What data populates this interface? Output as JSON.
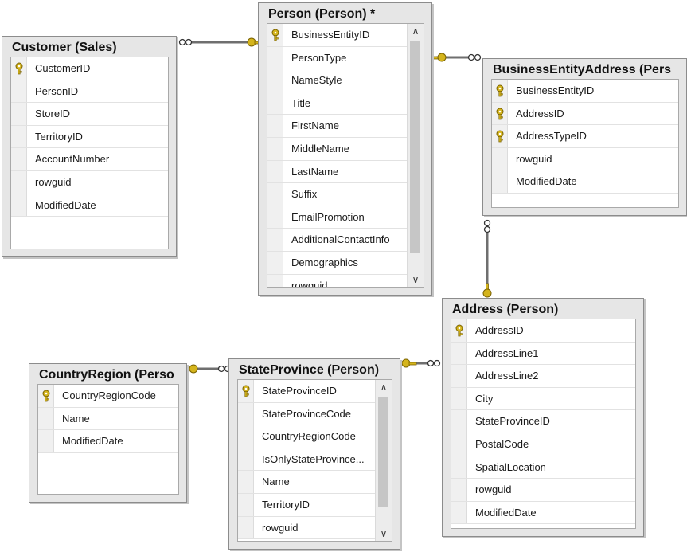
{
  "tables": {
    "customer": {
      "title": "Customer (Sales)",
      "columns": [
        {
          "name": "CustomerID",
          "key": true
        },
        {
          "name": "PersonID",
          "key": false
        },
        {
          "name": "StoreID",
          "key": false
        },
        {
          "name": "TerritoryID",
          "key": false
        },
        {
          "name": "AccountNumber",
          "key": false
        },
        {
          "name": "rowguid",
          "key": false
        },
        {
          "name": "ModifiedDate",
          "key": false
        }
      ]
    },
    "person": {
      "title": "Person (Person) *",
      "columns": [
        {
          "name": "BusinessEntityID",
          "key": true
        },
        {
          "name": "PersonType",
          "key": false
        },
        {
          "name": "NameStyle",
          "key": false
        },
        {
          "name": "Title",
          "key": false
        },
        {
          "name": "FirstName",
          "key": false
        },
        {
          "name": "MiddleName",
          "key": false
        },
        {
          "name": "LastName",
          "key": false
        },
        {
          "name": "Suffix",
          "key": false
        },
        {
          "name": "EmailPromotion",
          "key": false
        },
        {
          "name": "AdditionalContactInfo",
          "key": false
        },
        {
          "name": "Demographics",
          "key": false
        },
        {
          "name": "rowguid",
          "key": false
        }
      ]
    },
    "businessEntityAddress": {
      "title": "BusinessEntityAddress (Pers",
      "columns": [
        {
          "name": "BusinessEntityID",
          "key": true
        },
        {
          "name": "AddressID",
          "key": true
        },
        {
          "name": "AddressTypeID",
          "key": true
        },
        {
          "name": "rowguid",
          "key": false
        },
        {
          "name": "ModifiedDate",
          "key": false
        }
      ]
    },
    "address": {
      "title": "Address (Person)",
      "columns": [
        {
          "name": "AddressID",
          "key": true
        },
        {
          "name": "AddressLine1",
          "key": false
        },
        {
          "name": "AddressLine2",
          "key": false
        },
        {
          "name": "City",
          "key": false
        },
        {
          "name": "StateProvinceID",
          "key": false
        },
        {
          "name": "PostalCode",
          "key": false
        },
        {
          "name": "SpatialLocation",
          "key": false
        },
        {
          "name": "rowguid",
          "key": false
        },
        {
          "name": "ModifiedDate",
          "key": false
        }
      ]
    },
    "countryRegion": {
      "title": "CountryRegion (Perso",
      "columns": [
        {
          "name": "CountryRegionCode",
          "key": true
        },
        {
          "name": "Name",
          "key": false
        },
        {
          "name": "ModifiedDate",
          "key": false
        }
      ]
    },
    "stateProvince": {
      "title": "StateProvince (Person)",
      "columns": [
        {
          "name": "StateProvinceID",
          "key": true
        },
        {
          "name": "StateProvinceCode",
          "key": false
        },
        {
          "name": "CountryRegionCode",
          "key": false
        },
        {
          "name": "IsOnlyStateProvince...",
          "key": false
        },
        {
          "name": "Name",
          "key": false
        },
        {
          "name": "TerritoryID",
          "key": false
        },
        {
          "name": "rowguid",
          "key": false
        }
      ]
    }
  },
  "colors": {
    "key": "#d4b41c",
    "line": "#6f6f6f",
    "frame": "#e6e6e6"
  },
  "icons": {
    "key": "key-icon",
    "scroll_up": "scroll-up-arrow-icon",
    "scroll_down": "scroll-down-arrow-icon"
  }
}
